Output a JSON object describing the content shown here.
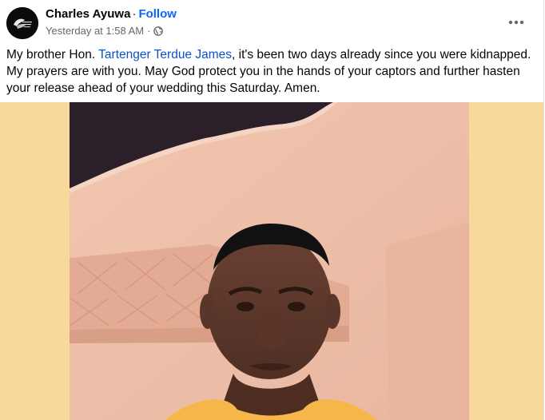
{
  "post": {
    "author": "Charles Ayuwa",
    "separator": "·",
    "follow_label": "Follow",
    "timestamp": "Yesterday at 1:58 AM",
    "meta_separator": "·",
    "audience_icon": "globe-icon",
    "more_icon": "more-options-icon",
    "caption": {
      "before": "My brother Hon. ",
      "mention": "Tartenger Terdue James",
      "after": ", it's been two days already since you were kidnapped. My prayers are with you. May God protect you in the hands of your captors and further hasten your release ahead of your wedding this Saturday. Amen."
    },
    "photo_backdrop_color": "#f9d99b",
    "link_color": "#0866ff"
  }
}
